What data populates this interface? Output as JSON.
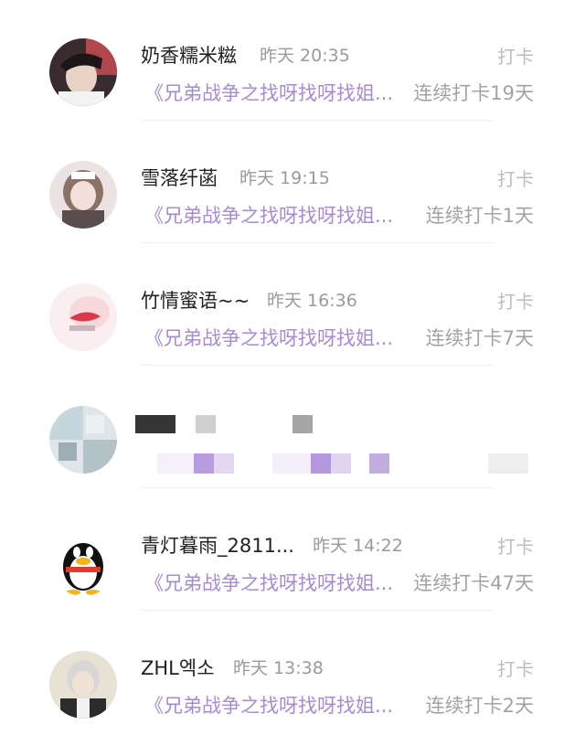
{
  "entries": [
    {
      "name": "奶香糯米糍",
      "time": "昨天 20:35",
      "action": "打卡",
      "book": "《兄弟战争之找呀找呀找姐...",
      "streak": "连续打卡19天"
    },
    {
      "name": "雪落纤菡",
      "time": "昨天 19:15",
      "action": "打卡",
      "book": "《兄弟战争之找呀找呀找姐...",
      "streak": "连续打卡1天"
    },
    {
      "name": "竹情蜜语~~",
      "time": "昨天 16:36",
      "action": "打卡",
      "book": "《兄弟战争之找呀找呀找姐...",
      "streak": "连续打卡7天"
    },
    {
      "name": "",
      "time": "",
      "action": "",
      "book": "",
      "streak": ""
    },
    {
      "name": "青灯暮雨_2811...",
      "time": "昨天 14:22",
      "action": "打卡",
      "book": "《兄弟战争之找呀找呀找姐...",
      "streak": "连续打卡47天"
    },
    {
      "name": "ZHL엑소",
      "time": "昨天 13:38",
      "action": "打卡",
      "book": "《兄弟战争之找呀找呀找姐...",
      "streak": "连续打卡2天"
    }
  ],
  "colors": {
    "book_link": "#a88ad8",
    "streak": "#a3a3a3",
    "time": "#9a9a9a",
    "action": "#bdbdbd"
  },
  "icons": {
    "row5_avatar": "qq-penguin-icon"
  }
}
